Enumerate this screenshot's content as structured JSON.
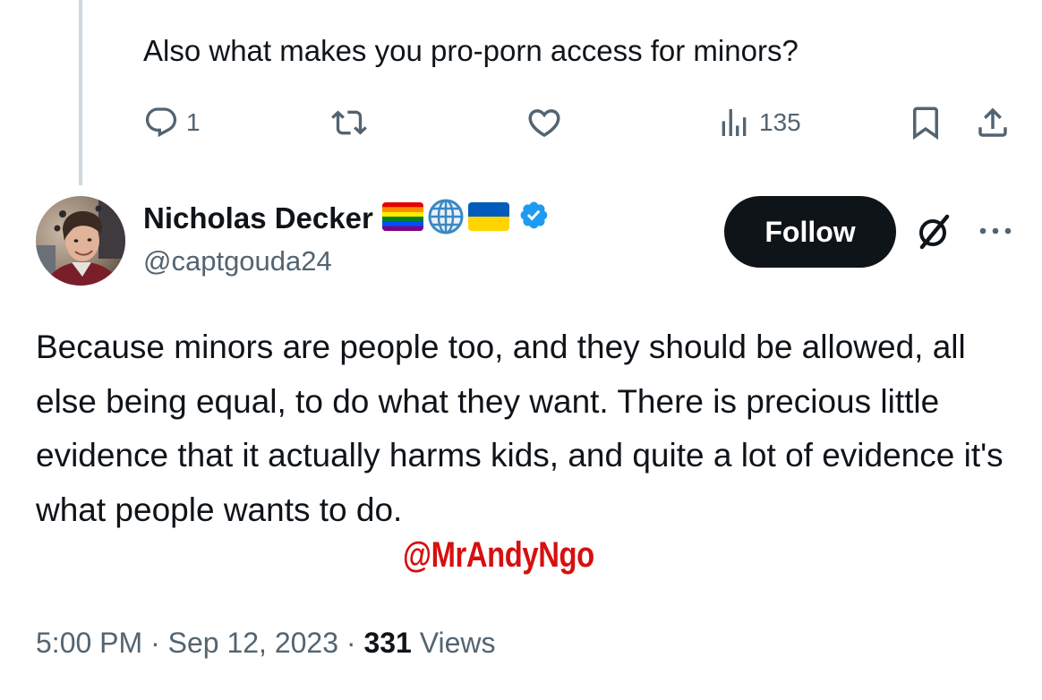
{
  "parent_tweet": {
    "text": "Also what makes you pro-porn access for minors?",
    "reply_count": "1",
    "view_count": "135"
  },
  "reply_tweet": {
    "display_name": "Nicholas Decker",
    "handle": "@captgouda24",
    "badges": [
      "rainbow-flag-emoji",
      "globe-emoji",
      "ukraine-flag-emoji",
      "verified-badge-icon"
    ],
    "follow_label": "Follow",
    "text": "Because minors are people too, and they should be allowed, all else being equal, to do what they want. There is precious little evidence that it actually harms kids, and quite a lot of evidence it's what people wants to do.",
    "time": "5:00 PM",
    "sep1": "·",
    "date": "Sep 12, 2023",
    "sep2": "·",
    "views_count": "331",
    "views_label": "Views"
  },
  "watermark": "@MrAndyNgo",
  "colors": {
    "text_primary": "#0f1419",
    "text_secondary": "#536471",
    "verified_blue": "#1d9bf0",
    "follow_bg": "#0f1419",
    "watermark_red": "#d70f0f",
    "thread_line": "#cfd9de"
  }
}
